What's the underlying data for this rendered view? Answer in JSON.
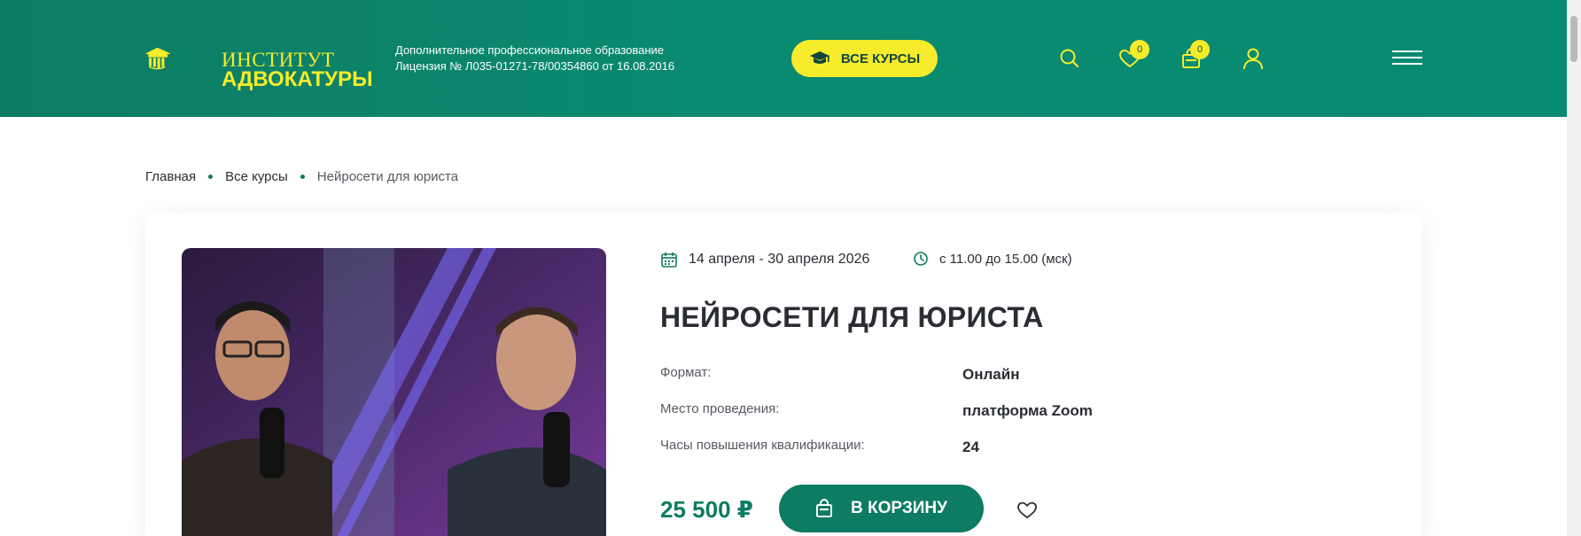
{
  "header": {
    "logo": {
      "line1": "ИНСТИТУТ",
      "line2": "АДВОКАТУРЫ"
    },
    "license": {
      "line1": "Дополнительное профессиональное образование",
      "line2": "Лицензия № Л035-01271-78/00354860 от 16.08.2016"
    },
    "all_courses_label": "ВСЕ КУРСЫ",
    "favorites_count": "0",
    "cart_count": "0",
    "icons": [
      "graduation-cap-icon",
      "search-icon",
      "heart-icon",
      "shopping-bag-icon",
      "user-icon",
      "menu-icon"
    ]
  },
  "breadcrumb": {
    "home": "Главная",
    "courses": "Все курсы",
    "current": "Нейросети для юриста"
  },
  "course": {
    "dates": "14 апреля - 30 апреля 2026",
    "time": "с 11.00 до 15.00 (мск)",
    "title": "НЕЙРОСЕТИ ДЛЯ ЮРИСТА",
    "props": [
      {
        "label": "Формат:",
        "value": "Онлайн"
      },
      {
        "label": "Место проведения:",
        "value": "платформа Zoom"
      },
      {
        "label": "Часы повышения квалификации:",
        "value": "24"
      }
    ],
    "price": "25 500 ₽",
    "cart_label": "В КОРЗИНУ"
  },
  "colors": {
    "brand_green": "#0d7c62",
    "accent_yellow": "#f6ec2b",
    "text_dark": "#2a2d33"
  }
}
